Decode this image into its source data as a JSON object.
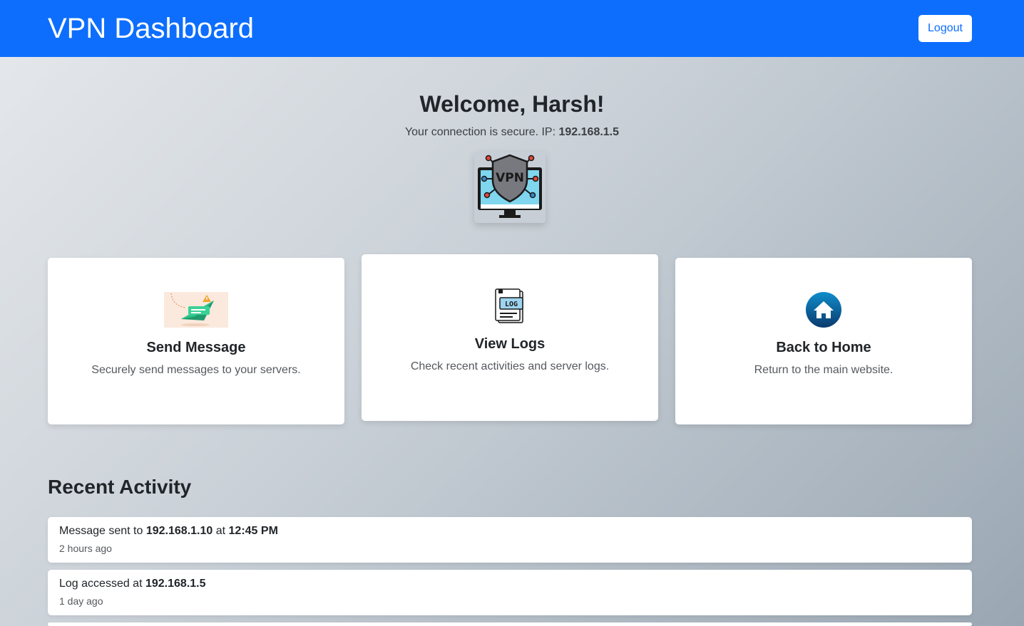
{
  "header": {
    "brand": "VPN Dashboard",
    "logout_label": "Logout"
  },
  "welcome": {
    "greeting": "Welcome, Harsh!",
    "status_prefix": "Your connection is secure. IP:",
    "ip": "192.168.1.5",
    "logo_text": "VPN"
  },
  "cards": [
    {
      "icon": "paper-plane-message-icon",
      "title": "Send Message",
      "description": "Securely send messages to your servers."
    },
    {
      "icon": "log-file-icon",
      "title": "View Logs",
      "description": "Check recent activities and server logs.",
      "icon_text": "LOG"
    },
    {
      "icon": "home-icon",
      "title": "Back to Home",
      "description": "Return to the main website."
    }
  ],
  "recent": {
    "title": "Recent Activity",
    "items": [
      {
        "prefix": "Message sent to",
        "ip": "192.168.1.10",
        "mid": "at",
        "time": "12:45 PM",
        "ago": "2 hours ago"
      },
      {
        "prefix": "Log accessed at",
        "ip": "192.168.1.5",
        "ago": "1 day ago"
      }
    ]
  },
  "colors": {
    "primary": "#0d6efd",
    "card_bg": "#ffffff",
    "home_icon": "#0a6ea3",
    "message_icon": "#22b07d"
  }
}
